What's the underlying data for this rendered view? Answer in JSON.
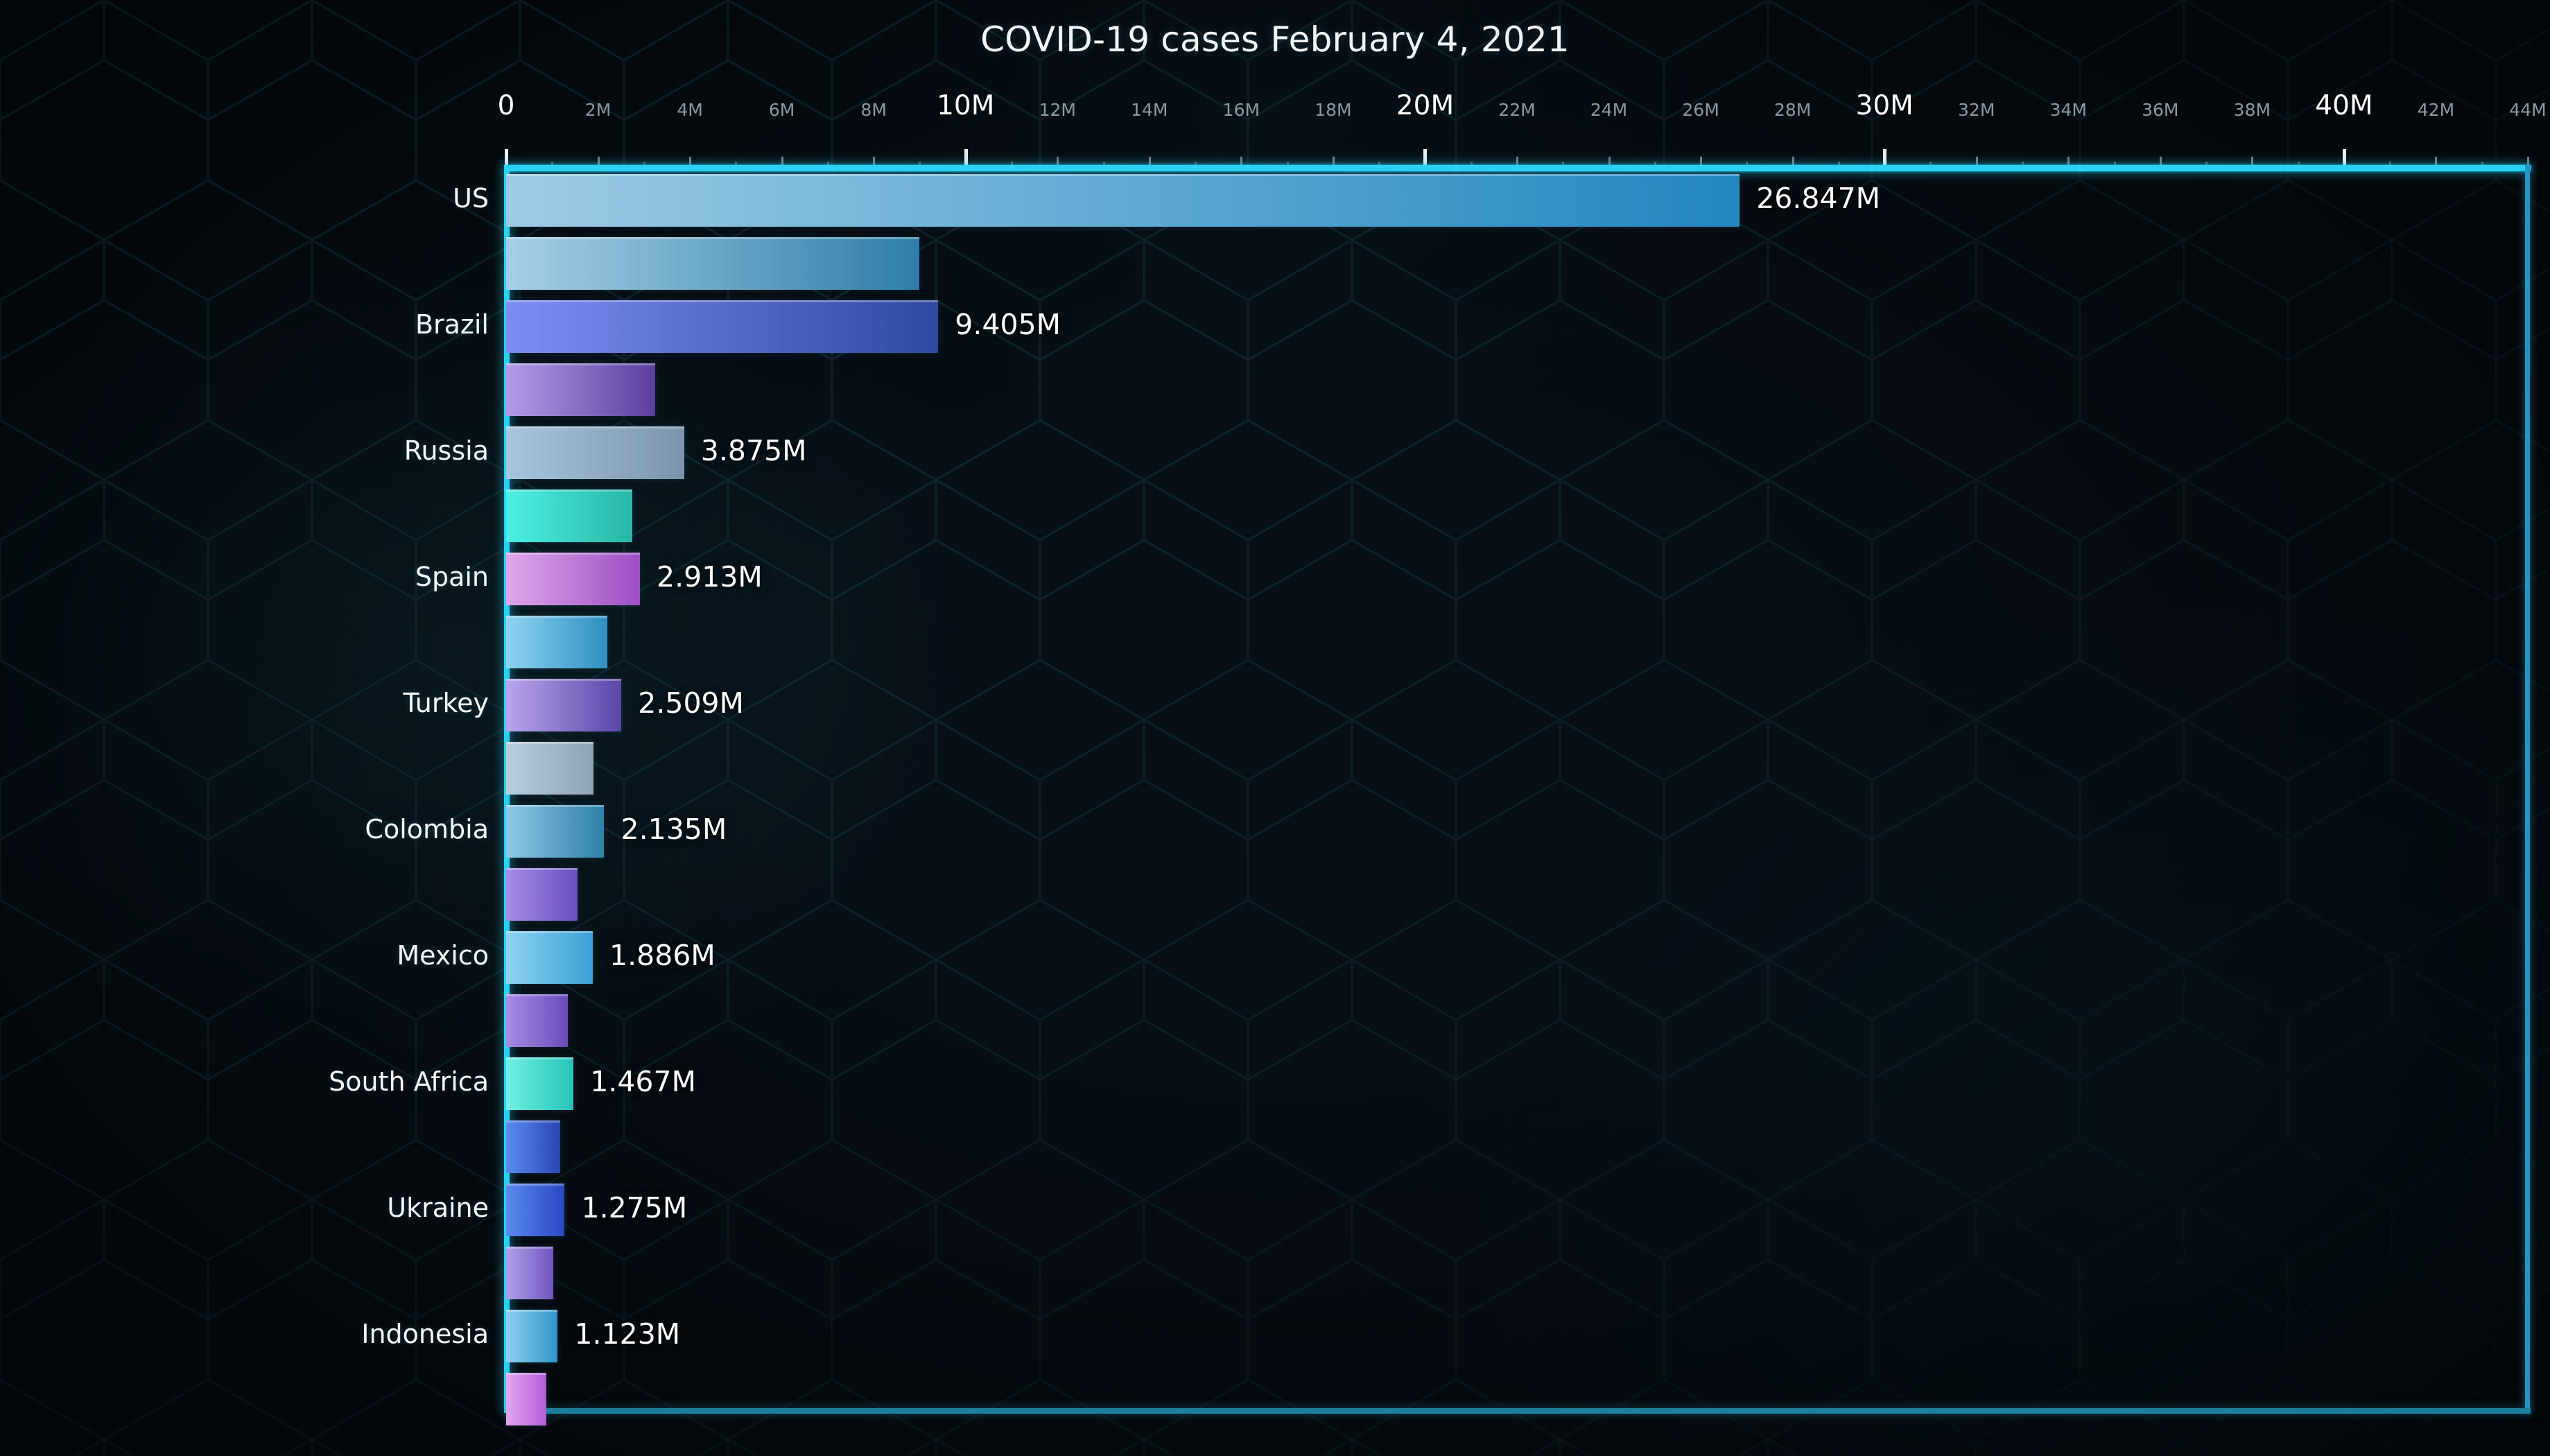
{
  "title": "COVID-19 cases February 4, 2021",
  "theme": {
    "background": "#070e15",
    "axis_accent": "#2ad2f5",
    "axis_dim": "#1e7e9e",
    "text": "#ffffff",
    "minor_tick_text": "#8b9aa2",
    "hex_edge": "#10353f"
  },
  "axis": {
    "min": 0,
    "max": 44000000,
    "major_step": 10000000,
    "minor_step": 2000000,
    "sub_step": 1000000,
    "tick_labels": [
      {
        "value": 0,
        "text": "0",
        "major": true
      },
      {
        "value": 2000000,
        "text": "2M",
        "major": false
      },
      {
        "value": 4000000,
        "text": "4M",
        "major": false
      },
      {
        "value": 6000000,
        "text": "6M",
        "major": false
      },
      {
        "value": 8000000,
        "text": "8M",
        "major": false
      },
      {
        "value": 10000000,
        "text": "10M",
        "major": true
      },
      {
        "value": 12000000,
        "text": "12M",
        "major": false
      },
      {
        "value": 14000000,
        "text": "14M",
        "major": false
      },
      {
        "value": 16000000,
        "text": "16M",
        "major": false
      },
      {
        "value": 18000000,
        "text": "18M",
        "major": false
      },
      {
        "value": 20000000,
        "text": "20M",
        "major": true
      },
      {
        "value": 22000000,
        "text": "22M",
        "major": false
      },
      {
        "value": 24000000,
        "text": "24M",
        "major": false
      },
      {
        "value": 26000000,
        "text": "26M",
        "major": false
      },
      {
        "value": 28000000,
        "text": "28M",
        "major": false
      },
      {
        "value": 30000000,
        "text": "30M",
        "major": true
      },
      {
        "value": 32000000,
        "text": "32M",
        "major": false
      },
      {
        "value": 34000000,
        "text": "34M",
        "major": false
      },
      {
        "value": 36000000,
        "text": "36M",
        "major": false
      },
      {
        "value": 38000000,
        "text": "38M",
        "major": false
      },
      {
        "value": 40000000,
        "text": "40M",
        "major": true
      },
      {
        "value": 42000000,
        "text": "42M",
        "major": false
      },
      {
        "value": 44000000,
        "text": "44M",
        "major": false
      }
    ]
  },
  "chart_data": {
    "type": "bar",
    "orientation": "horizontal",
    "title": "COVID-19 cases February 4, 2021",
    "xlabel": "",
    "ylabel": "",
    "xlim": [
      0,
      44000000
    ],
    "grid": false,
    "legend": null,
    "value_suffix": "M",
    "categories": [
      "US",
      "Brazil",
      "Russia",
      "Spain",
      "Turkey",
      "Colombia",
      "Mexico",
      "South Africa",
      "Ukraine",
      "Indonesia"
    ],
    "values": [
      26847000,
      9405000,
      3875000,
      2913000,
      2509000,
      2135000,
      1886000,
      1467000,
      1275000,
      1123000
    ],
    "value_labels": [
      "26.847M",
      "9.405M",
      "3.875M",
      "2.913M",
      "2.509M",
      "2.135M",
      "1.886M",
      "1.467M",
      "1.275M",
      "1.123M"
    ],
    "secondary_values": [
      9000000,
      3250000,
      2750000,
      2200000,
      1900000,
      1550000,
      1350000,
      1180000,
      1020000,
      880000
    ],
    "note": "Each category draws a labelled primary bar plus an unlabelled secondary bar beneath it."
  },
  "bars": [
    {
      "category": "US",
      "value_label": "26.847M",
      "value": 26847000,
      "secondary": 9000000,
      "from": "#9dcbe4",
      "to": "#2387c0",
      "s_from": "#a6cfe6",
      "s_to": "#2f7ea8"
    },
    {
      "category": "Brazil",
      "value_label": "9.405M",
      "value": 9405000,
      "secondary": 3250000,
      "from": "#7d8cf5",
      "to": "#2e4ba0",
      "s_from": "#b49ce8",
      "s_to": "#5a3f9e"
    },
    {
      "category": "Russia",
      "value_label": "3.875M",
      "value": 3875000,
      "secondary": 2750000,
      "from": "#a7c6dd",
      "to": "#7b95ab",
      "s_from": "#4cf0e4",
      "s_to": "#28b7a8"
    },
    {
      "category": "Spain",
      "value_label": "2.913M",
      "value": 2913000,
      "secondary": 2200000,
      "from": "#dfa7ea",
      "to": "#9c4fc4",
      "s_from": "#8fd4f2",
      "s_to": "#2f8fc0"
    },
    {
      "category": "Turkey",
      "value_label": "2.509M",
      "value": 2509000,
      "secondary": 1900000,
      "from": "#b9a6ec",
      "to": "#5a46a8",
      "s_from": "#b8cfdd",
      "s_to": "#8fa3b2"
    },
    {
      "category": "Colombia",
      "value_label": "2.135M",
      "value": 2135000,
      "secondary": 1550000,
      "from": "#90c9e6",
      "to": "#2e7fa8",
      "s_from": "#a78ce8",
      "s_to": "#6a4fbe"
    },
    {
      "category": "Mexico",
      "value_label": "1.886M",
      "value": 1886000,
      "secondary": 1350000,
      "from": "#8fd4f2",
      "to": "#3aa0d4",
      "s_from": "#a88ce6",
      "s_to": "#6a4cb8"
    },
    {
      "category": "South Africa",
      "value_label": "1.467M",
      "value": 1467000,
      "secondary": 1180000,
      "from": "#6ff0e4",
      "to": "#28c4b8",
      "s_from": "#5a8cf0",
      "s_to": "#2a46b4"
    },
    {
      "category": "Ukraine",
      "value_label": "1.275M",
      "value": 1275000,
      "secondary": 1020000,
      "from": "#5a8cf0",
      "to": "#2a46c4",
      "s_from": "#b0a0ea",
      "s_to": "#6f56c0"
    },
    {
      "category": "Indonesia",
      "value_label": "1.123M",
      "value": 1123000,
      "secondary": 880000,
      "from": "#8fd0f0",
      "to": "#2f95c8",
      "s_from": "#e0a8f0",
      "s_to": "#b55cd8"
    }
  ]
}
